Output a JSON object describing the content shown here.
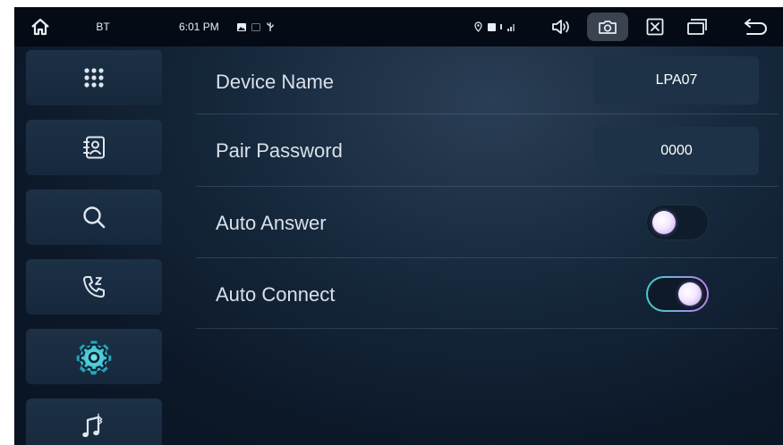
{
  "status_bar": {
    "app_label": "BT",
    "time": "6:01 PM",
    "icons": [
      "home-icon",
      "gallery-icon",
      "usb-icon",
      "location-icon",
      "signal-icon",
      "volume-icon",
      "camera-icon",
      "close-window-icon",
      "multi-window-icon",
      "back-icon"
    ]
  },
  "sidebar": {
    "items": [
      {
        "icon": "dialpad-icon",
        "selected": false
      },
      {
        "icon": "contacts-icon",
        "selected": false
      },
      {
        "icon": "search-icon",
        "selected": false
      },
      {
        "icon": "call-log-icon",
        "selected": false
      },
      {
        "icon": "settings-icon",
        "selected": true
      },
      {
        "icon": "bluetooth-music-icon",
        "selected": false
      }
    ]
  },
  "settings": {
    "device_name": {
      "label": "Device Name",
      "value": "LPA07"
    },
    "pair_password": {
      "label": "Pair Password",
      "value": "0000"
    },
    "auto_answer": {
      "label": "Auto Answer",
      "enabled": false
    },
    "auto_connect": {
      "label": "Auto Connect",
      "enabled": true
    }
  },
  "colors": {
    "accent_cyan": "#3fd0c8",
    "accent_purple": "#c07cf2",
    "background": "#0c1828"
  }
}
